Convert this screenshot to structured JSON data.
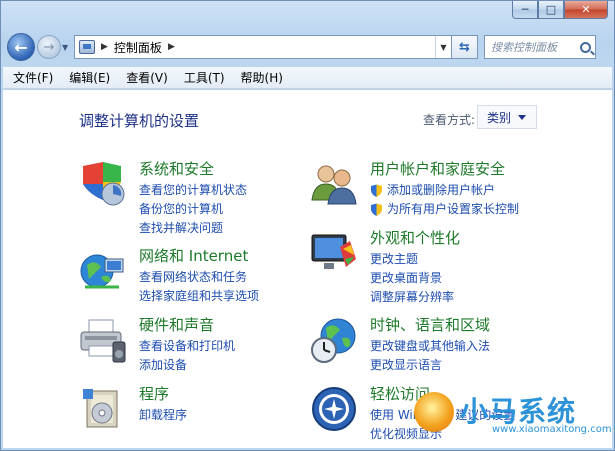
{
  "window": {
    "caption": {
      "minimize": "─",
      "maximize": "□",
      "close": "✕"
    }
  },
  "nav": {
    "back": "←",
    "forward": "→",
    "address_path": "控制面板",
    "search_placeholder": "搜索控制面板"
  },
  "menu": [
    "文件(F)",
    "编辑(E)",
    "查看(V)",
    "工具(T)",
    "帮助(H)"
  ],
  "content": {
    "title": "调整计算机的设置",
    "view_by_label": "查看方式:",
    "view_by_value": "类别"
  },
  "categories": [
    {
      "title": "系统和安全",
      "icon": "shield-flag-icon",
      "links": [
        "查看您的计算机状态",
        "备份您的计算机",
        "查找并解决问题"
      ]
    },
    {
      "title": "网络和 Internet",
      "icon": "network-globe-icon",
      "links": [
        "查看网络状态和任务",
        "选择家庭组和共享选项"
      ]
    },
    {
      "title": "硬件和声音",
      "icon": "printer-icon",
      "links": [
        "查看设备和打印机",
        "添加设备"
      ]
    },
    {
      "title": "程序",
      "icon": "programs-box-icon",
      "links": [
        "卸载程序"
      ]
    },
    {
      "title": "用户帐户和家庭安全",
      "icon": "users-icon",
      "links": [
        "添加或删除用户帐户",
        "为所有用户设置家长控制"
      ]
    },
    {
      "title": "外观和个性化",
      "icon": "monitor-palette-icon",
      "links": [
        "更改主题",
        "更改桌面背景",
        "调整屏幕分辨率"
      ]
    },
    {
      "title": "时钟、语言和区域",
      "icon": "clock-globe-icon",
      "links": [
        "更改键盘或其他输入法",
        "更改显示语言"
      ]
    },
    {
      "title": "轻松访问",
      "icon": "ease-of-access-icon",
      "links": [
        "使用 Windows 建议的设置",
        "优化视频显示"
      ]
    }
  ],
  "watermark": {
    "logo": "小马系统",
    "url": "www.xiaomaxitong.com"
  }
}
